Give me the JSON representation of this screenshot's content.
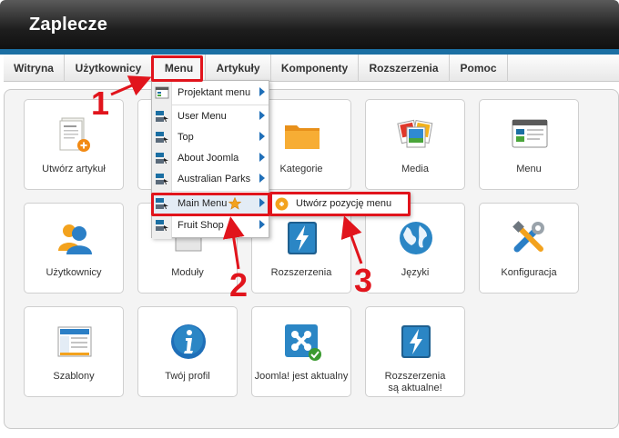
{
  "header": {
    "title": "Zaplecze"
  },
  "nav": {
    "items": [
      "Witryna",
      "Użytkownicy",
      "Menu",
      "Artykuły",
      "Komponenty",
      "Rozszerzenia",
      "Pomoc"
    ]
  },
  "dropdown": {
    "items": [
      {
        "label": "Projektant menu",
        "icon": "menu-manager-icon",
        "has_submenu": true
      },
      {
        "label": "User Menu",
        "icon": "menu-icon",
        "has_submenu": true
      },
      {
        "label": "Top",
        "icon": "menu-icon",
        "has_submenu": true
      },
      {
        "label": "About Joomla",
        "icon": "menu-icon",
        "has_submenu": true
      },
      {
        "label": "Australian Parks",
        "icon": "menu-icon",
        "has_submenu": true
      },
      {
        "label": "Main Menu",
        "icon": "menu-icon",
        "has_submenu": true,
        "default_star": true
      },
      {
        "label": "Fruit Shop",
        "icon": "menu-icon",
        "has_submenu": true
      }
    ]
  },
  "submenu": {
    "item": "Utwórz pozycję menu",
    "icon": "add-icon"
  },
  "tiles": [
    {
      "label": "Utwórz artykuł",
      "icon": "new-article-icon"
    },
    {
      "label": "",
      "icon": "article-manager-icon"
    },
    {
      "label": "Kategorie",
      "icon": "folder-icon"
    },
    {
      "label": "Media",
      "icon": "media-icon"
    },
    {
      "label": "Menu",
      "icon": "menu-manager-icon"
    },
    {
      "label": "Użytkownicy",
      "icon": "users-icon"
    },
    {
      "label": "Moduły",
      "icon": "modules-icon"
    },
    {
      "label": "Rozszerzenia",
      "icon": "extensions-icon"
    },
    {
      "label": "Języki",
      "icon": "globe-icon"
    },
    {
      "label": "Konfiguracja",
      "icon": "tools-icon"
    },
    {
      "label": "Szablony",
      "icon": "templates-icon"
    },
    {
      "label": "Twój profil",
      "icon": "info-icon"
    },
    {
      "label": "Joomla! jest aktualny",
      "icon": "joomla-icon"
    },
    {
      "label_line1": "Rozszerzenia",
      "label_line2": "są aktualne!",
      "icon": "extensions-update-icon"
    }
  ],
  "annotations": [
    "1",
    "2",
    "3"
  ],
  "colors": {
    "accent_blue": "#1b6fa3",
    "annotation_red": "#e1141c",
    "header_dark": "#1e1e1e"
  }
}
